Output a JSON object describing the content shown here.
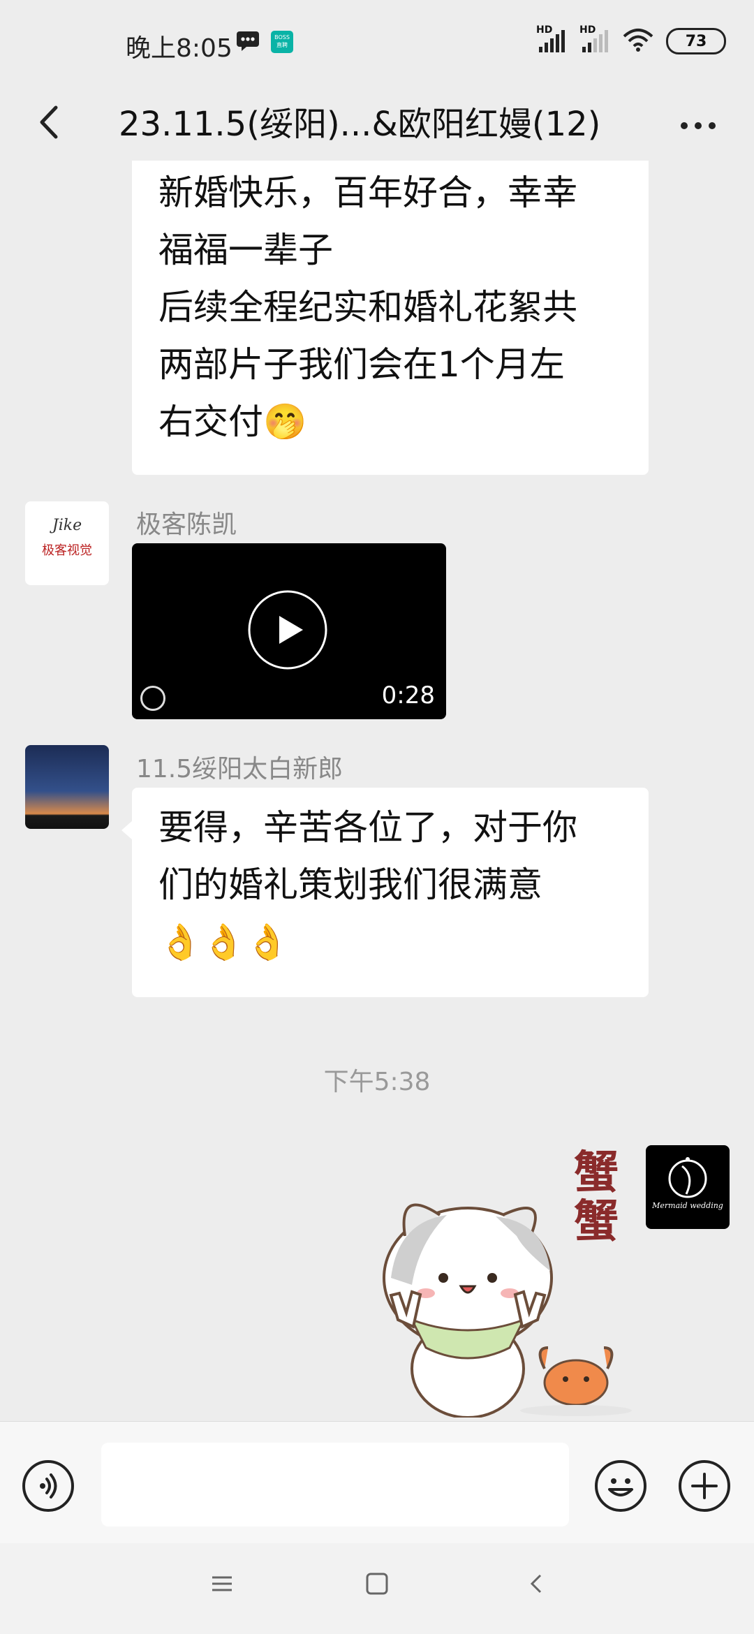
{
  "status_bar": {
    "time": "晚上8:05",
    "network_1": "HD",
    "network_2": "HD",
    "battery": "73",
    "app_badge": "BOSS\n直聘"
  },
  "header": {
    "title": "23.11.5(绥阳)...&欧阳红嫚(12)",
    "back_icon": "chevron-left-icon",
    "more_icon": "more-dots-icon"
  },
  "messages": [
    {
      "type": "text",
      "lines": [
        "新婚快乐，百年好合，幸幸",
        "福福一辈子",
        "后续全程纪实和婚礼花絮共",
        "两部片子我们会在1个月左",
        "右交付🤭"
      ]
    },
    {
      "type": "video",
      "sender": "极客陈凯",
      "duration": "0:28",
      "avatar_text": "极客视觉",
      "avatar_script": "Jike"
    },
    {
      "type": "text",
      "sender": "11.5绥阳太白新郎",
      "lines": [
        "要得，辛苦各位了，对于你",
        "们的婚礼策划我们很满意",
        "👌👌👌"
      ]
    },
    {
      "type": "time",
      "text": "下午5:38"
    },
    {
      "type": "sticker",
      "sticker_text": "蟹蟹",
      "avatar_text": "Mermaid wedding"
    }
  ],
  "input_bar": {
    "voice_icon": "voice-icon",
    "emoji_icon": "emoji-icon",
    "plus_icon": "plus-icon",
    "placeholder": ""
  },
  "nav_bar": {
    "menu_icon": "menu-icon",
    "home_icon": "home-icon",
    "back_icon": "back-icon"
  }
}
